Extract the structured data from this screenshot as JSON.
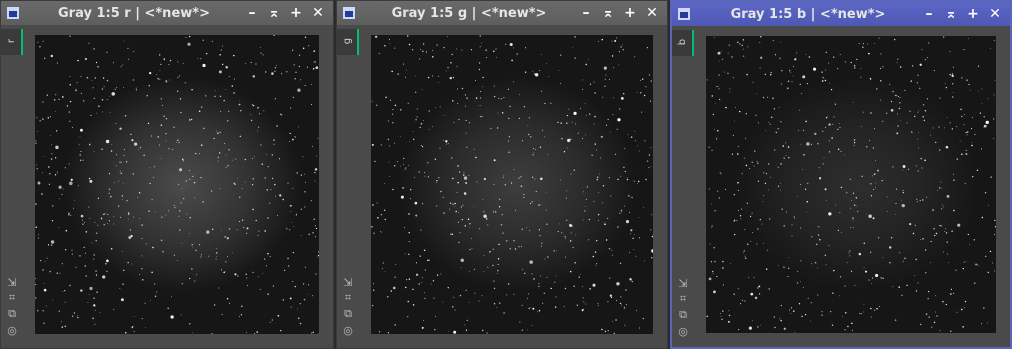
{
  "windows": [
    {
      "title": "Gray 1:5 r | <*new*>",
      "tab_label": "r",
      "active": false,
      "nebula_intensity": 1.0
    },
    {
      "title": "Gray 1:5 g | <*new*>",
      "tab_label": "g",
      "active": false,
      "nebula_intensity": 0.75
    },
    {
      "title": "Gray 1:5 b | <*new*>",
      "tab_label": "b",
      "active": true,
      "nebula_intensity": 0.45
    }
  ],
  "controls": {
    "minimize": "–",
    "shade": "⌅",
    "maximize": "+",
    "close": "✕"
  },
  "tools": {
    "zoom_to_fit": "⇲",
    "crosshair": "⌗",
    "clone": "⧉",
    "reset": "◎"
  },
  "colors": {
    "active_border": "#5a66b8",
    "tab_marker": "#00c070"
  }
}
